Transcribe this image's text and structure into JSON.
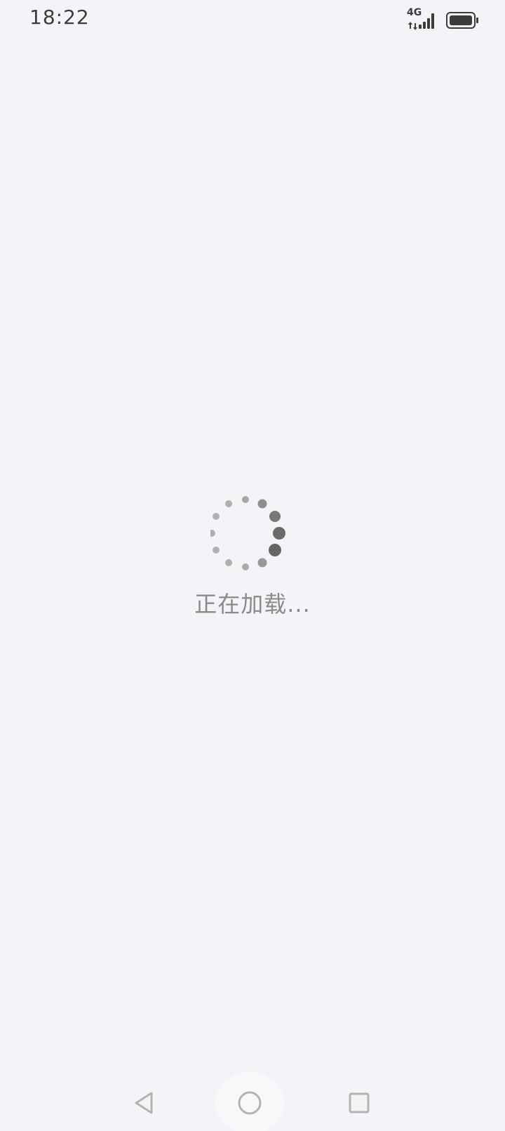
{
  "status_bar": {
    "time": "18:22",
    "network_type": "4G",
    "signal_icon": "signal-bars-icon",
    "battery_icon": "battery-icon"
  },
  "loader": {
    "spinner_icon": "loading-spinner-icon",
    "text": "正在加载..."
  },
  "nav_bar": {
    "back_icon": "back-triangle-icon",
    "home_icon": "home-circle-icon",
    "recent_icon": "recent-square-icon"
  },
  "colors": {
    "background": "#F3F4F8",
    "text_muted": "#8a8a8a",
    "icon_dark": "#3c3c3c"
  }
}
